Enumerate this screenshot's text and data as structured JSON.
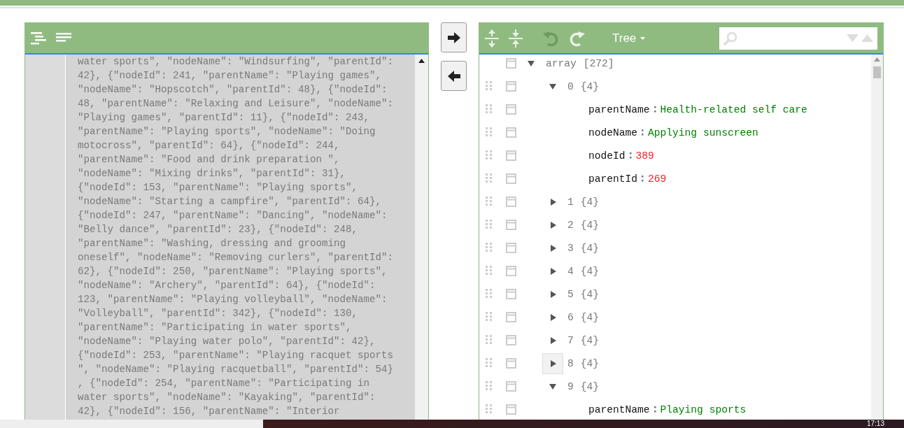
{
  "code_panel": {
    "lines": [
      "water sports\", \"nodeName\": \"Windsurfing\", \"parentId\":",
      "42}, {\"nodeId\": 241, \"parentName\": \"Playing games\",",
      "\"nodeName\": \"Hopscotch\", \"parentId\": 48}, {\"nodeId\":",
      "48, \"parentName\": \"Relaxing and Leisure\", \"nodeName\":",
      "\"Playing games\", \"parentId\": 11}, {\"nodeId\": 243,",
      "\"parentName\": \"Playing sports\", \"nodeName\": \"Doing",
      "motocross\", \"parentId\": 64}, {\"nodeId\": 244,",
      "\"parentName\": \"Food and drink preparation \",",
      "\"nodeName\": \"Mixing drinks\", \"parentId\": 31},",
      "{\"nodeId\": 153, \"parentName\": \"Playing sports\",",
      "\"nodeName\": \"Starting a campfire\", \"parentId\": 64},",
      "{\"nodeId\": 247, \"parentName\": \"Dancing\", \"nodeName\":",
      "\"Belly dance\", \"parentId\": 23}, {\"nodeId\": 248,",
      "\"parentName\": \"Washing, dressing and grooming",
      "oneself\", \"nodeName\": \"Removing curlers\", \"parentId\":",
      "62}, {\"nodeId\": 250, \"parentName\": \"Playing sports\",",
      "\"nodeName\": \"Archery\", \"parentId\": 64}, {\"nodeId\":",
      "123, \"parentName\": \"Playing volleyball\", \"nodeName\":",
      "\"Volleyball\", \"parentId\": 342}, {\"nodeId\": 130,",
      "\"parentName\": \"Participating in water sports\",",
      "\"nodeName\": \"Playing water polo\", \"parentId\": 42},",
      "{\"nodeId\": 253, \"parentName\": \"Playing racquet sports",
      "\", \"nodeName\": \"Playing racquetball\", \"parentId\": 54}",
      ", {\"nodeId\": 254, \"parentName\": \"Participating in",
      "water sports\", \"nodeName\": \"Kayaking\", \"parentId\":",
      "42}, {\"nodeId\": 156, \"parentName\": \"Interior"
    ]
  },
  "tree_panel": {
    "mode_button": "Tree",
    "undo_disabled": true,
    "redo_disabled": false,
    "root": {
      "label": "array",
      "count": "[272]",
      "expanded": true,
      "hovered": false,
      "children": [
        {
          "label": "0",
          "count": "{4}",
          "expanded": true,
          "hovered": false,
          "children": [
            {
              "key": "parentName",
              "value": "Health-related self care",
              "kind": "string"
            },
            {
              "key": "nodeName",
              "value": "Applying sunscreen",
              "kind": "string"
            },
            {
              "key": "nodeId",
              "value": "389",
              "kind": "number"
            },
            {
              "key": "parentId",
              "value": "269",
              "kind": "number"
            }
          ]
        },
        {
          "label": "1",
          "count": "{4}",
          "expanded": false,
          "hovered": false
        },
        {
          "label": "2",
          "count": "{4}",
          "expanded": false,
          "hovered": false
        },
        {
          "label": "3",
          "count": "{4}",
          "expanded": false,
          "hovered": false
        },
        {
          "label": "4",
          "count": "{4}",
          "expanded": false,
          "hovered": false
        },
        {
          "label": "5",
          "count": "{4}",
          "expanded": false,
          "hovered": false
        },
        {
          "label": "6",
          "count": "{4}",
          "expanded": false,
          "hovered": false
        },
        {
          "label": "7",
          "count": "{4}",
          "expanded": false,
          "hovered": false
        },
        {
          "label": "8",
          "count": "{4}",
          "expanded": false,
          "hovered": true
        },
        {
          "label": "9",
          "count": "{4}",
          "expanded": true,
          "hovered": false,
          "children": [
            {
              "key": "parentName",
              "value": "Playing sports",
              "kind": "string"
            }
          ]
        }
      ]
    }
  },
  "taskbar": {
    "time": "17:13"
  }
}
